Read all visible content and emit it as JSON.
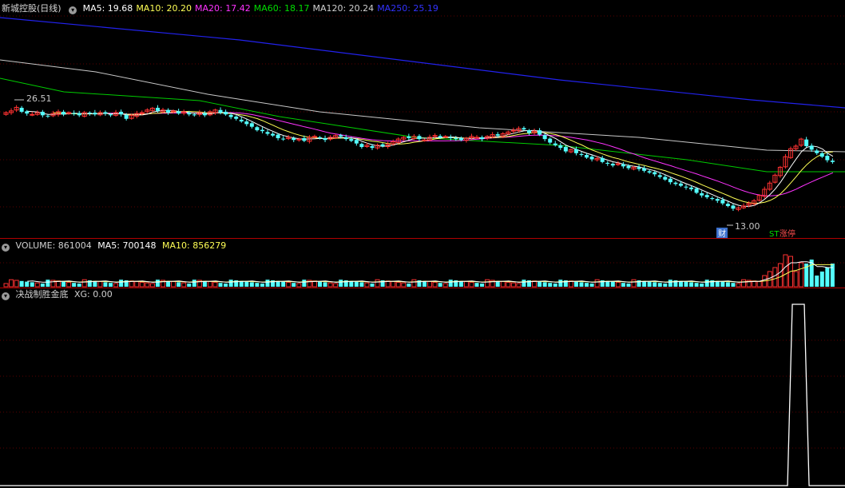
{
  "main": {
    "title": "新城控股(日线)",
    "ma": [
      {
        "label": "MA5: 19.68",
        "color": "#ffffff"
      },
      {
        "label": "MA10: 20.20",
        "color": "#ffff55"
      },
      {
        "label": "MA20: 17.42",
        "color": "#ff33ff"
      },
      {
        "label": "MA60: 18.17",
        "color": "#00dd00"
      },
      {
        "label": "MA120: 20.24",
        "color": "#d0d0d0"
      },
      {
        "label": "MA250: 25.19",
        "color": "#3333ff"
      }
    ],
    "high_label": "26.51",
    "low_label": "13.00",
    "marker_cai": "财",
    "marker_zhangting": "涨停",
    "marker_zhangting_prefix": "ST",
    "marker_zt_color": "#00dd00"
  },
  "volume": {
    "label": "VOLUME: 861004",
    "ma5": "MA5: 700148",
    "ma10": "MA10: 856279",
    "ma5_color": "#ffffff",
    "ma10_color": "#ffff55"
  },
  "indicator": {
    "name": "决战制胜金底",
    "xg": "XG: 0.00"
  },
  "chart_data": {
    "type": "candlestick",
    "title": "新城控股(日线)",
    "high": 26.51,
    "low": 13.0,
    "ma_latest": {
      "MA5": 19.68,
      "MA10": 20.2,
      "MA20": 17.42,
      "MA60": 18.17,
      "MA120": 20.24,
      "MA250": 25.19
    },
    "volume_latest": {
      "VOLUME": 861004,
      "MA5": 700148,
      "MA10": 856279
    },
    "indicator_latest": {
      "XG": 0.0
    },
    "xg_signal_candle": 151,
    "closes": [
      25.6,
      25.8,
      26.2,
      25.7,
      25.5,
      25.4,
      25.6,
      25.3,
      25.2,
      25.5,
      25.7,
      25.4,
      25.6,
      25.5,
      25.3,
      25.6,
      25.5,
      25.4,
      25.6,
      25.5,
      25.3,
      25.6,
      25.4,
      24.9,
      25.3,
      25.5,
      25.6,
      25.9,
      26.1,
      25.8,
      25.9,
      25.6,
      25.8,
      25.5,
      25.7,
      25.4,
      25.3,
      25.6,
      25.3,
      25.7,
      25.9,
      25.6,
      25.4,
      25.1,
      24.9,
      24.6,
      24.3,
      24.0,
      23.6,
      23.5,
      23.2,
      23.0,
      22.7,
      22.6,
      22.8,
      22.5,
      22.6,
      22.4,
      22.8,
      22.9,
      22.7,
      22.5,
      22.8,
      23.0,
      22.9,
      22.6,
      22.4,
      22.1,
      21.7,
      21.9,
      21.6,
      21.9,
      21.8,
      22.0,
      22.3,
      22.6,
      22.8,
      22.7,
      22.9,
      22.6,
      22.5,
      22.8,
      23.0,
      22.8,
      22.9,
      22.7,
      22.6,
      22.5,
      22.7,
      22.9,
      22.8,
      22.6,
      22.9,
      23.1,
      23.0,
      23.2,
      23.4,
      23.6,
      23.8,
      23.7,
      23.3,
      23.5,
      23.1,
      22.6,
      22.2,
      21.9,
      21.6,
      21.2,
      21.4,
      21.0,
      20.8,
      20.5,
      20.3,
      20.4,
      20.0,
      19.8,
      19.6,
      19.8,
      19.5,
      19.3,
      19.4,
      19.2,
      19.0,
      18.8,
      18.6,
      18.3,
      18.0,
      17.7,
      17.5,
      17.3,
      17.1,
      16.9,
      16.5,
      16.2,
      16.0,
      15.8,
      15.6,
      15.3,
      15.0,
      14.7,
      14.8,
      15.0,
      15.3,
      15.6,
      16.2,
      16.9,
      17.6,
      18.5,
      19.4,
      20.6,
      21.5,
      21.8,
      22.6,
      21.8,
      21.4,
      21.0,
      20.6,
      20.2,
      20.0
    ]
  }
}
